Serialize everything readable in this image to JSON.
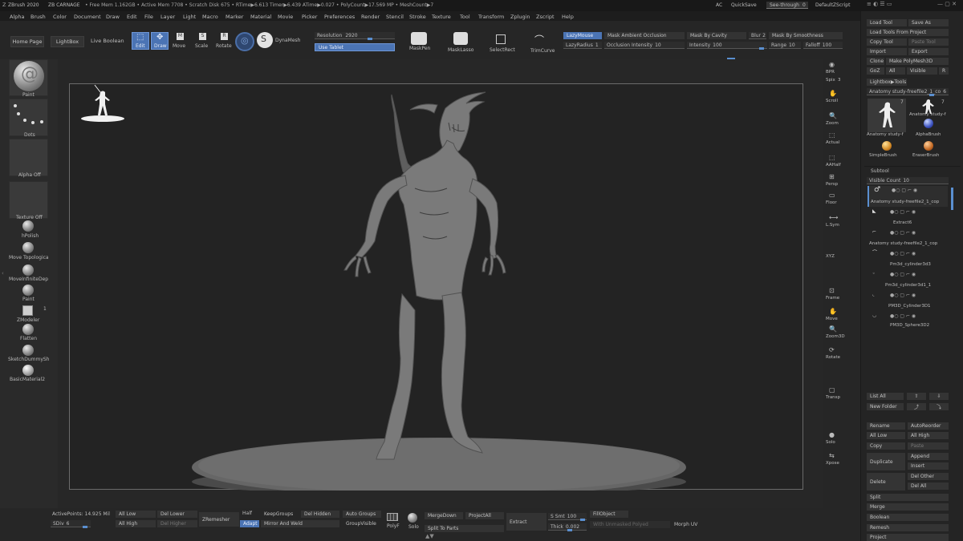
{
  "topbar": {
    "app": "ZBrush 2020",
    "doc": "ZB CARNAGE",
    "stats": "• Free Mem 1.162GB • Active Mem 7708 • Scratch Disk 675 • RTime▶6.613 Timer▶6.439 ATime▶0.027 • PolyCount▶17.569 MP • MeshCount▶7",
    "ac": "AC",
    "quicksave": "QuickSave",
    "see_through": "See-through",
    "see_through_value": "0",
    "zscript": "DefaultZScript"
  },
  "menu": [
    "Alpha",
    "Brush",
    "Color",
    "Document",
    "Draw",
    "Edit",
    "File",
    "Layer",
    "Light",
    "Macro",
    "Marker",
    "Material",
    "Movie",
    "Picker",
    "Preferences",
    "Render",
    "Stencil",
    "Stroke",
    "Texture",
    "Tool",
    "Transform",
    "Zplugin",
    "Zscript",
    "Help"
  ],
  "shelf": {
    "home": "Home Page",
    "lightbox": "LightBox",
    "live_boolean": "Live Boolean",
    "edit": "Edit",
    "draw": "Draw",
    "move": "Move",
    "scale": "Scale",
    "rotate": "Rotate",
    "dynamesh": "DynaMesh",
    "resolution_label": "Resolution",
    "resolution_value": "2920",
    "use_tablet": "Use Tablet",
    "maskpen": "MaskPen",
    "masklasso": "MaskLasso",
    "selectrect": "SelectRect",
    "trimcurve": "TrimCurve",
    "lazymouse": "LazyMouse",
    "lazyradius": "LazyRadius",
    "lazyradius_value": "1",
    "mask_ambient": "Mask Ambient Occlusion",
    "occlusion": "Occlusion Intensity",
    "occlusion_value": "10",
    "mask_cavity": "Mask By Cavity",
    "intensity": "Intensity",
    "intensity_value": "100",
    "blur": "Blur",
    "blur_value": "2",
    "mask_smooth": "Mask By Smoothness",
    "range": "Range",
    "range_value": "10",
    "falloff": "Falloff",
    "falloff_value": "100"
  },
  "left": {
    "paint": "Paint",
    "dots": "Dots",
    "alpha": "Alpha Off",
    "texture": "Texture Off",
    "brushes": [
      "hPolish",
      "Move Topologica",
      "MoveInfiniteDep",
      "Paint",
      "ZModeler",
      "Flatten",
      "SketchDummySh",
      "BasicMaterial2"
    ],
    "zmodeler_count": "1"
  },
  "rshelf": [
    "BPR",
    "Spix",
    "Scroll",
    "Zoom",
    "Actual",
    "AAHalf",
    "Persp",
    "Floor",
    "L.Sym",
    "XYZ",
    "Frame",
    "Move",
    "Zoom3D",
    "Rotate",
    "Transp",
    "Solo",
    "Xpose"
  ],
  "rshelf_spix_value": "3",
  "rpanel": {
    "load_tool": "Load Tool",
    "save_as": "Save As",
    "load_tools_project": "Load Tools From Project",
    "copy_tool": "Copy Tool",
    "paste_tool": "Paste Tool",
    "import": "Import",
    "export": "Export",
    "clone": "Clone",
    "make_polymesh": "Make PolyMesh3D",
    "goz": "GoZ",
    "all": "All",
    "visible": "Visible",
    "r": "R",
    "lightbox_tools": "Lightbox▶Tools",
    "current_tool": "Anatomy study-freefile2_1_co",
    "current_tool_count": "6",
    "thumbs": [
      "Anatomy study-f",
      "Anatomy study-f",
      "AlphaBrush",
      "SimpleBrush",
      "EraserBrush"
    ],
    "thumb_counts": [
      "7",
      "7"
    ],
    "subtool": "Subtool",
    "visible_count": "Visible Count",
    "visible_count_value": "10",
    "subtools": [
      "Anatomy study-freefile2_1_cop",
      "Extract6",
      "Anatomy study-freefile2_1_cop",
      "Pm3d_cylinder3d3",
      "Pm3d_cylinder3d1_1",
      "PM3D_Cylinder3D1",
      "PM3D_Sphere3D2"
    ],
    "list_all": "List All",
    "new_folder": "New Folder",
    "rename": "Rename",
    "autoreorder": "AutoReorder",
    "all_low": "All Low",
    "all_high": "All High",
    "copy": "Copy",
    "paste": "Paste",
    "duplicate": "Duplicate",
    "append": "Append",
    "insert": "Insert",
    "delete": "Delete",
    "del_other": "Del Other",
    "del_all": "Del All",
    "split": "Split",
    "merge": "Merge",
    "boolean": "Boolean",
    "remesh": "Remesh",
    "project": "Project"
  },
  "bottom": {
    "active_points": "ActivePoints: 14.925 Mil",
    "sdiv": "SDiv",
    "sdiv_value": "6",
    "all_low": "All Low",
    "all_high": "All High",
    "del_lower": "Del Lower",
    "del_higher": "Del Higher",
    "zremesher": "ZRemesher",
    "half": "Half",
    "adapt": "Adapt",
    "keepgroups": "KeepGroups",
    "mirror_weld": "Mirror And Weld",
    "del_hidden": "Del Hidden",
    "auto_groups": "Auto Groups",
    "groupvisible": "GroupVisible",
    "polyf": "PolyF",
    "solo": "Solo",
    "mergedown": "MergeDown",
    "projectall": "ProjectAll",
    "split_parts": "Split To Parts",
    "extract": "Extract",
    "s_smt": "S Smt",
    "s_smt_value": "100",
    "thick": "Thick",
    "thick_value": "0.002",
    "fillobject": "FillObject",
    "with_unmasked": "With Unmasked Polyed",
    "morph_uv": "Morph UV"
  }
}
